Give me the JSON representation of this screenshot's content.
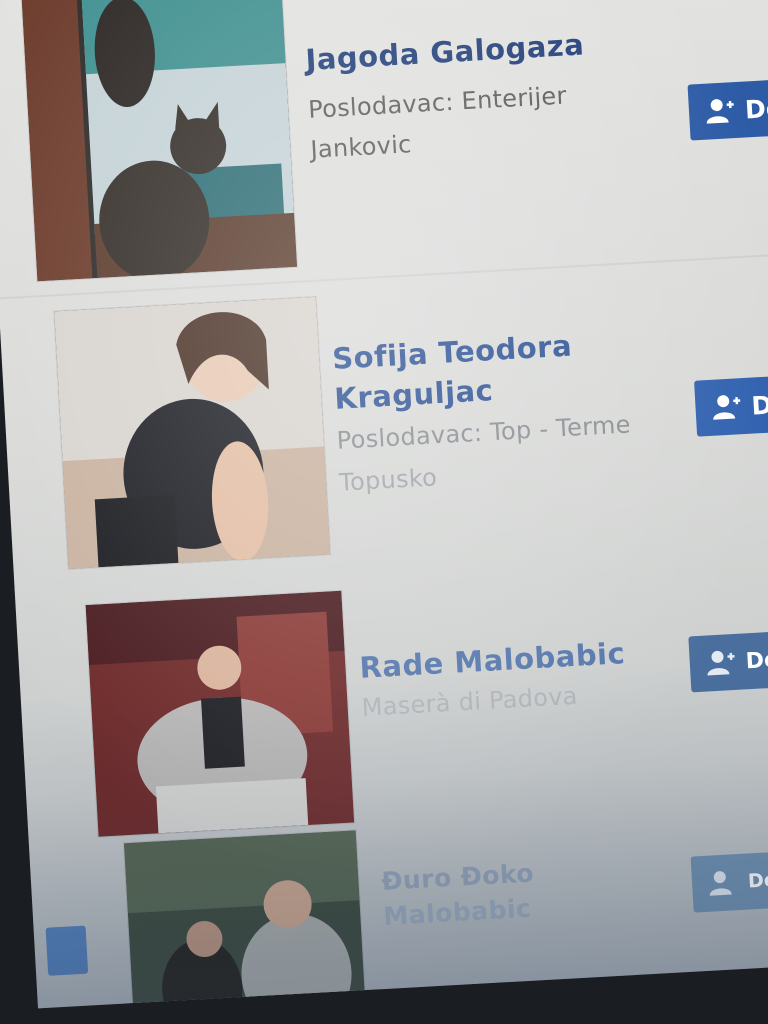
{
  "colors": {
    "name_link": "#2d4f8f",
    "name_link_light": "#4b6ea8",
    "employer_text": "#5f5f5f",
    "button_bg": "#2f5fae",
    "button_text": "#ffffff"
  },
  "people": [
    {
      "name": "Jagoda Galogaza",
      "employer_line1": "Poslodavac: Enterijer",
      "employer_line2": "Jankovic",
      "button_label": "Dod",
      "button_icon": "add-friend-icon",
      "photo": "gray cat sitting by a window"
    },
    {
      "name_line1": "Sofija Teodora",
      "name_line2": "Kraguljac",
      "employer_line1": "Poslodavac: Top - Terme",
      "employer_line2": "Topusko",
      "button_label": "Doda",
      "button_icon": "add-friend-icon",
      "photo": "young woman in black top"
    },
    {
      "name": "Rade Malobabic",
      "employer_line1": "Maserà di Padova",
      "button_label": "Dodajte",
      "button_icon": "add-friend-icon",
      "photo": "man sitting in a red room"
    },
    {
      "name_line1": "Đuro Đoko",
      "name_line2": "Malobabic",
      "button_label": "Dodajte p",
      "button_icon": "add-friend-icon",
      "photo": "two people outdoors"
    }
  ]
}
